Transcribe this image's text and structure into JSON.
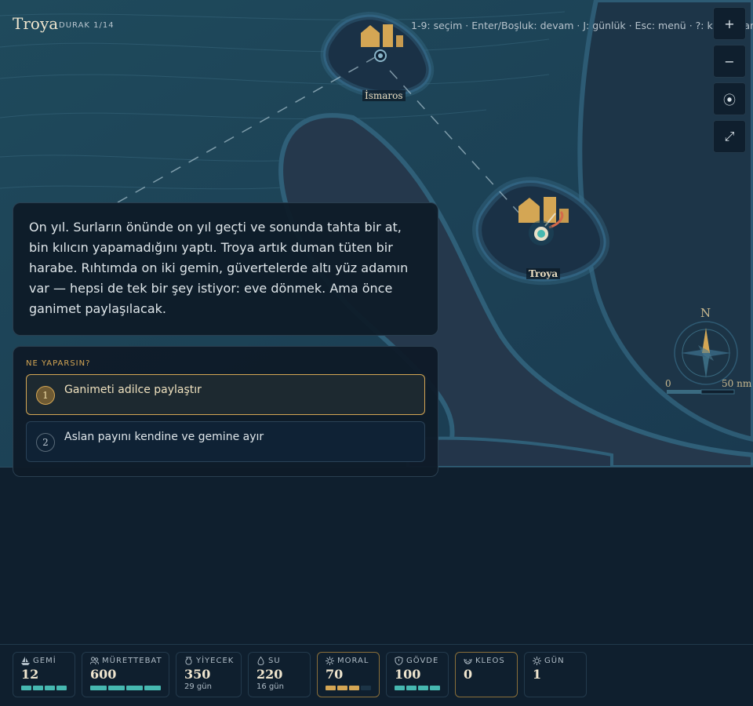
{
  "header": {
    "title": "Troya",
    "stop": "DURAK 1/14",
    "shortcuts": "1-9: seçim · Enter/Boşluk: devam · J: günlük · Esc: menü · ?: kısayollar"
  },
  "map_controls": [
    {
      "label": "+",
      "name": "zoom-in-button"
    },
    {
      "label": "−",
      "name": "zoom-out-button"
    },
    {
      "label": "⦿",
      "name": "center-map-button"
    },
    {
      "label": "⤢",
      "name": "fullscreen-button"
    }
  ],
  "places": {
    "ismaros": "İsmaros",
    "troy": "Troya"
  },
  "compass": {
    "north": "N"
  },
  "scale": {
    "start": "0",
    "end": "50 nm"
  },
  "narrative": "On yıl. Surların önünde on yıl geçti ve sonunda tahta bir at, bin kılıcın yapamadığını yaptı. Troya artık duman tüten bir harabe. Rıhtımda on iki gemin, güvertelerde altı yüz adamın var — hepsi de tek bir şey istiyor: eve dönmek. Ama önce ganimet paylaşılacak.",
  "choices": {
    "prompt": "NE YAPARSIN?",
    "items": [
      {
        "num": "1",
        "label": "Ganimeti adilce paylaştır",
        "selected": true
      },
      {
        "num": "2",
        "label": "Aslan payını kendine ve gemine ayır",
        "selected": false
      }
    ]
  },
  "stats": [
    {
      "id": "gemi",
      "label": "GEMİ",
      "value": "12",
      "icon": "ship-icon",
      "bar": {
        "segments": 4,
        "filled": 4,
        "color": "teal"
      }
    },
    {
      "id": "murettebat",
      "label": "MÜRETTEBAT",
      "value": "600",
      "icon": "crew-icon",
      "bar": {
        "segments": 4,
        "filled": 4,
        "color": "teal"
      }
    },
    {
      "id": "yiyecek",
      "label": "YİYECEK",
      "value": "350",
      "sub": "29 gün",
      "icon": "food-sack-icon"
    },
    {
      "id": "su",
      "label": "SU",
      "value": "220",
      "sub": "16 gün",
      "icon": "water-drop-icon"
    },
    {
      "id": "moral",
      "label": "MORAL",
      "value": "70",
      "icon": "morale-sun-icon",
      "warn": true,
      "bar": {
        "segments": 4,
        "filled": 3,
        "color": "gold"
      }
    },
    {
      "id": "govde",
      "label": "GÖVDE",
      "value": "100",
      "icon": "hull-shield-icon",
      "bar": {
        "segments": 4,
        "filled": 4,
        "color": "teal"
      }
    },
    {
      "id": "kleos",
      "label": "KLEOS",
      "value": "0",
      "icon": "laurel-icon",
      "warn": true
    },
    {
      "id": "gun",
      "label": "GÜN",
      "value": "1",
      "icon": "day-sun-icon"
    }
  ],
  "colors": {
    "accent": "#d4a654",
    "teal": "#46b8b0",
    "panel": "#0e1b28",
    "sea": "#1c4055"
  }
}
